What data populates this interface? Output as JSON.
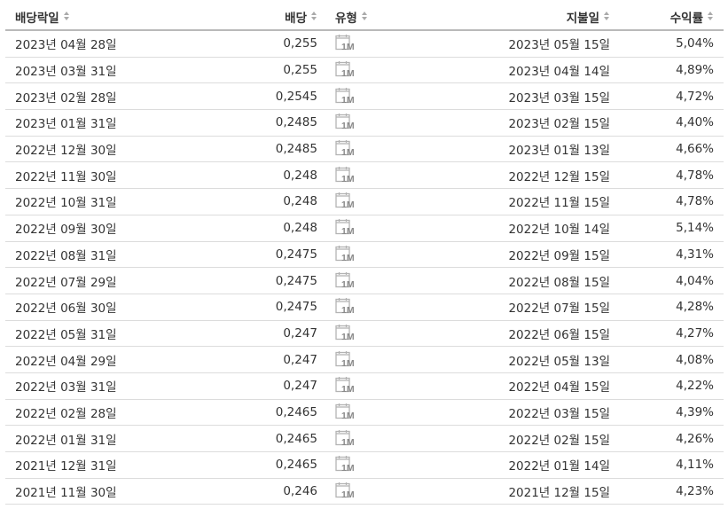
{
  "headers": {
    "ex_date": "배당락일",
    "amount": "배당",
    "type": "유형",
    "pay_date": "지불일",
    "yield": "수익률"
  },
  "type_icon": "monthly-calendar-icon",
  "type_icon_text": "1M",
  "rows": [
    {
      "ex_date": "2023년 04월 28일",
      "amount": "0,255",
      "pay_date": "2023년 05월 15일",
      "yield": "5,04%"
    },
    {
      "ex_date": "2023년 03월 31일",
      "amount": "0,255",
      "pay_date": "2023년 04월 14일",
      "yield": "4,89%"
    },
    {
      "ex_date": "2023년 02월 28일",
      "amount": "0,2545",
      "pay_date": "2023년 03월 15일",
      "yield": "4,72%"
    },
    {
      "ex_date": "2023년 01월 31일",
      "amount": "0,2485",
      "pay_date": "2023년 02월 15일",
      "yield": "4,40%"
    },
    {
      "ex_date": "2022년 12월 30일",
      "amount": "0,2485",
      "pay_date": "2023년 01월 13일",
      "yield": "4,66%"
    },
    {
      "ex_date": "2022년 11월 30일",
      "amount": "0,248",
      "pay_date": "2022년 12월 15일",
      "yield": "4,78%"
    },
    {
      "ex_date": "2022년 10월 31일",
      "amount": "0,248",
      "pay_date": "2022년 11월 15일",
      "yield": "4,78%"
    },
    {
      "ex_date": "2022년 09월 30일",
      "amount": "0,248",
      "pay_date": "2022년 10월 14일",
      "yield": "5,14%"
    },
    {
      "ex_date": "2022년 08월 31일",
      "amount": "0,2475",
      "pay_date": "2022년 09월 15일",
      "yield": "4,31%"
    },
    {
      "ex_date": "2022년 07월 29일",
      "amount": "0,2475",
      "pay_date": "2022년 08월 15일",
      "yield": "4,04%"
    },
    {
      "ex_date": "2022년 06월 30일",
      "amount": "0,2475",
      "pay_date": "2022년 07월 15일",
      "yield": "4,28%"
    },
    {
      "ex_date": "2022년 05월 31일",
      "amount": "0,247",
      "pay_date": "2022년 06월 15일",
      "yield": "4,27%"
    },
    {
      "ex_date": "2022년 04월 29일",
      "amount": "0,247",
      "pay_date": "2022년 05월 13일",
      "yield": "4,08%"
    },
    {
      "ex_date": "2022년 03월 31일",
      "amount": "0,247",
      "pay_date": "2022년 04월 15일",
      "yield": "4,22%"
    },
    {
      "ex_date": "2022년 02월 28일",
      "amount": "0,2465",
      "pay_date": "2022년 03월 15일",
      "yield": "4,39%"
    },
    {
      "ex_date": "2022년 01월 31일",
      "amount": "0,2465",
      "pay_date": "2022년 02월 15일",
      "yield": "4,26%"
    },
    {
      "ex_date": "2021년 12월 31일",
      "amount": "0,2465",
      "pay_date": "2022년 01월 14일",
      "yield": "4,11%"
    },
    {
      "ex_date": "2021년 11월 30일",
      "amount": "0,246",
      "pay_date": "2021년 12월 15일",
      "yield": "4,23%"
    }
  ]
}
